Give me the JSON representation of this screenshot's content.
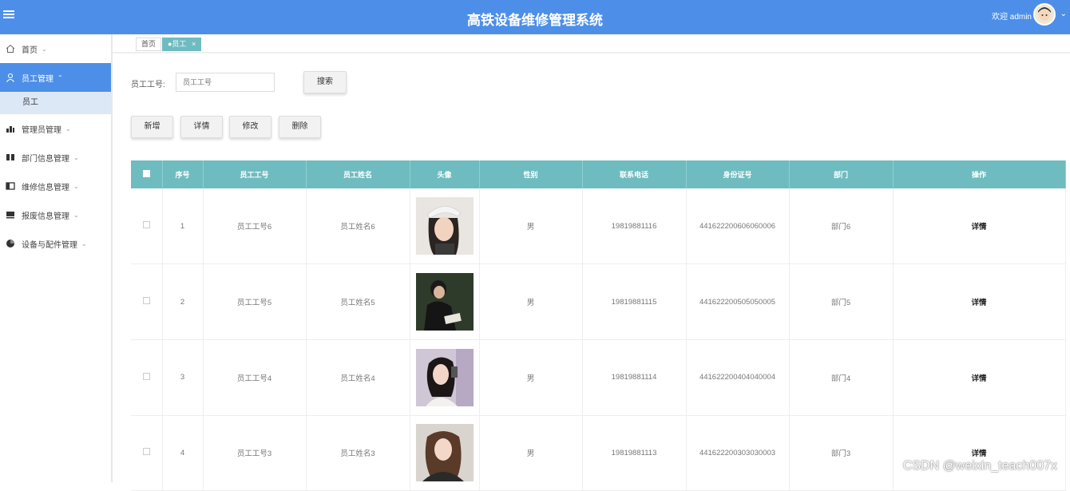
{
  "header": {
    "title": "高铁设备维修管理系统",
    "welcome": "欢迎 admin"
  },
  "sidebar": {
    "items": [
      {
        "label": "首页",
        "icon": "home-icon"
      },
      {
        "label": "员工管理",
        "icon": "user-icon"
      },
      {
        "label": "管理员管理",
        "icon": "chart-icon"
      },
      {
        "label": "部门信息管理",
        "icon": "columns-icon"
      },
      {
        "label": "维修信息管理",
        "icon": "panel-icon"
      },
      {
        "label": "报废信息管理",
        "icon": "layout-icon"
      },
      {
        "label": "设备与配件管理",
        "icon": "pie-icon"
      }
    ],
    "submenu": {
      "label": "员工"
    }
  },
  "tabs": [
    {
      "label": "首页"
    },
    {
      "label": "●员工",
      "close": "×"
    }
  ],
  "search": {
    "label": "员工工号:",
    "placeholder": "员工工号",
    "button": "搜索"
  },
  "actions": {
    "add": "新增",
    "detail": "详情",
    "edit": "修改",
    "delete": "删除"
  },
  "table": {
    "headers": [
      "序号",
      "员工工号",
      "员工姓名",
      "头像",
      "性别",
      "联系电话",
      "身份证号",
      "部门",
      "操作"
    ],
    "rows": [
      {
        "index": "1",
        "emp_no": "员工工号6",
        "name": "员工姓名6",
        "gender": "男",
        "phone": "19819881116",
        "id_card": "441622200606060006",
        "dept": "部门6",
        "op": "详情"
      },
      {
        "index": "2",
        "emp_no": "员工工号5",
        "name": "员工姓名5",
        "gender": "男",
        "phone": "19819881115",
        "id_card": "441622200505050005",
        "dept": "部门5",
        "op": "详情"
      },
      {
        "index": "3",
        "emp_no": "员工工号4",
        "name": "员工姓名4",
        "gender": "男",
        "phone": "19819881114",
        "id_card": "441622200404040004",
        "dept": "部门4",
        "op": "详情"
      },
      {
        "index": "4",
        "emp_no": "员工工号3",
        "name": "员工姓名3",
        "gender": "男",
        "phone": "19819881113",
        "id_card": "441622200303030003",
        "dept": "部门3",
        "op": "详情"
      }
    ]
  },
  "watermark": "CSDN @weixin_teach007x",
  "colors": {
    "primary": "#4d8fe8",
    "table_header": "#6fbcc0"
  }
}
